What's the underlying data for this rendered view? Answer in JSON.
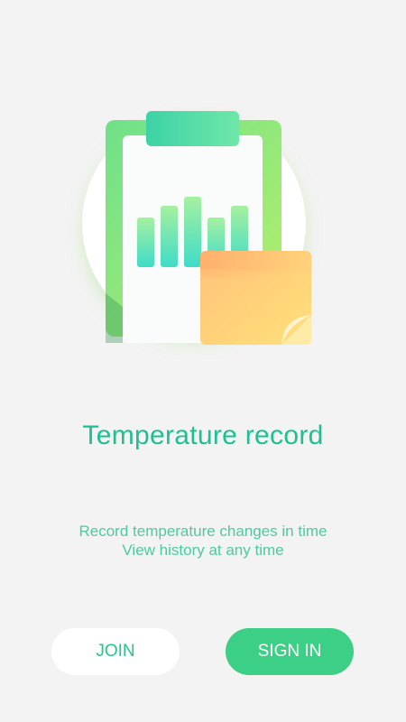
{
  "header": {
    "illustration_icon": "clipboard-chart-with-sticky-note"
  },
  "main": {
    "title": "Temperature record",
    "subtitle_lines": [
      "Record temperature changes in time",
      "View history at any time"
    ]
  },
  "actions": {
    "join_label": "JOIN",
    "signin_label": "SIGN IN"
  },
  "colors": {
    "accent": "#1fbf93",
    "button_primary": "#3ccf86",
    "background": "#f2f3f2"
  }
}
